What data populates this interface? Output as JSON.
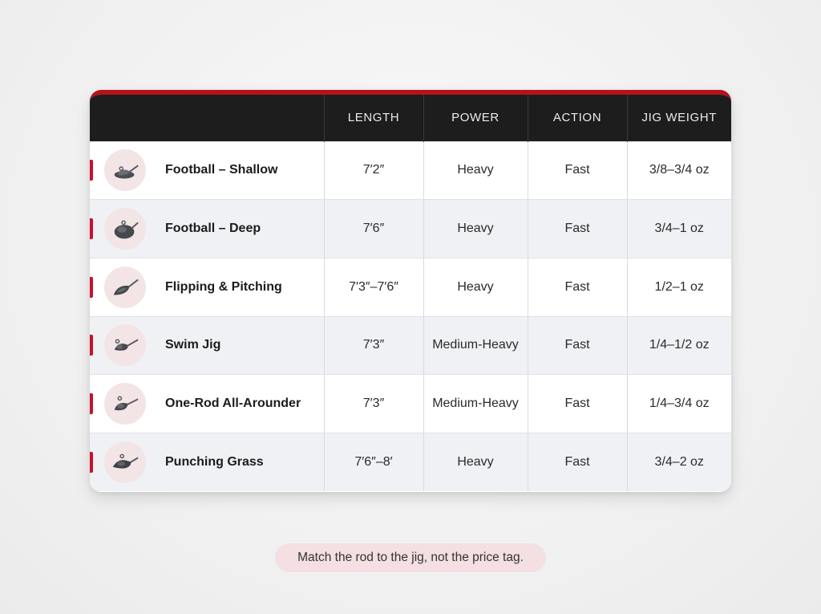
{
  "table": {
    "headers": [
      "",
      "LENGTH",
      "POWER",
      "ACTION",
      "JIG WEIGHT"
    ],
    "rows": [
      {
        "name": "Football – Shallow",
        "icon": "football-jig-shallow-icon",
        "length": "7′2″",
        "power": "Heavy",
        "action": "Fast",
        "weight": "3/8–3/4 oz"
      },
      {
        "name": "Football – Deep",
        "icon": "football-jig-deep-icon",
        "length": "7′6″",
        "power": "Heavy",
        "action": "Fast",
        "weight": "3/4–1 oz"
      },
      {
        "name": "Flipping & Pitching",
        "icon": "flipping-jig-icon",
        "length": "7′3″–7′6″",
        "power": "Heavy",
        "action": "Fast",
        "weight": "1/2–1 oz"
      },
      {
        "name": "Swim Jig",
        "icon": "swim-jig-icon",
        "length": "7′3″",
        "power": "Medium-Heavy",
        "action": "Fast",
        "weight": "1/4–1/2 oz"
      },
      {
        "name": "One-Rod All-Arounder",
        "icon": "all-around-jig-icon",
        "length": "7′3″",
        "power": "Medium-Heavy",
        "action": "Fast",
        "weight": "1/4–3/4 oz"
      },
      {
        "name": "Punching Grass",
        "icon": "punching-jig-icon",
        "length": "7′6″–8′",
        "power": "Heavy",
        "action": "Fast",
        "weight": "3/4–2 oz"
      }
    ]
  },
  "footer": {
    "tagline": "Match the rod to the jig, not the price tag."
  },
  "colors": {
    "accent": "#c8102e",
    "header_bg": "#1d1d1d",
    "icon_bg": "#f3e4e6",
    "tag_bg": "#f4dfe2"
  }
}
